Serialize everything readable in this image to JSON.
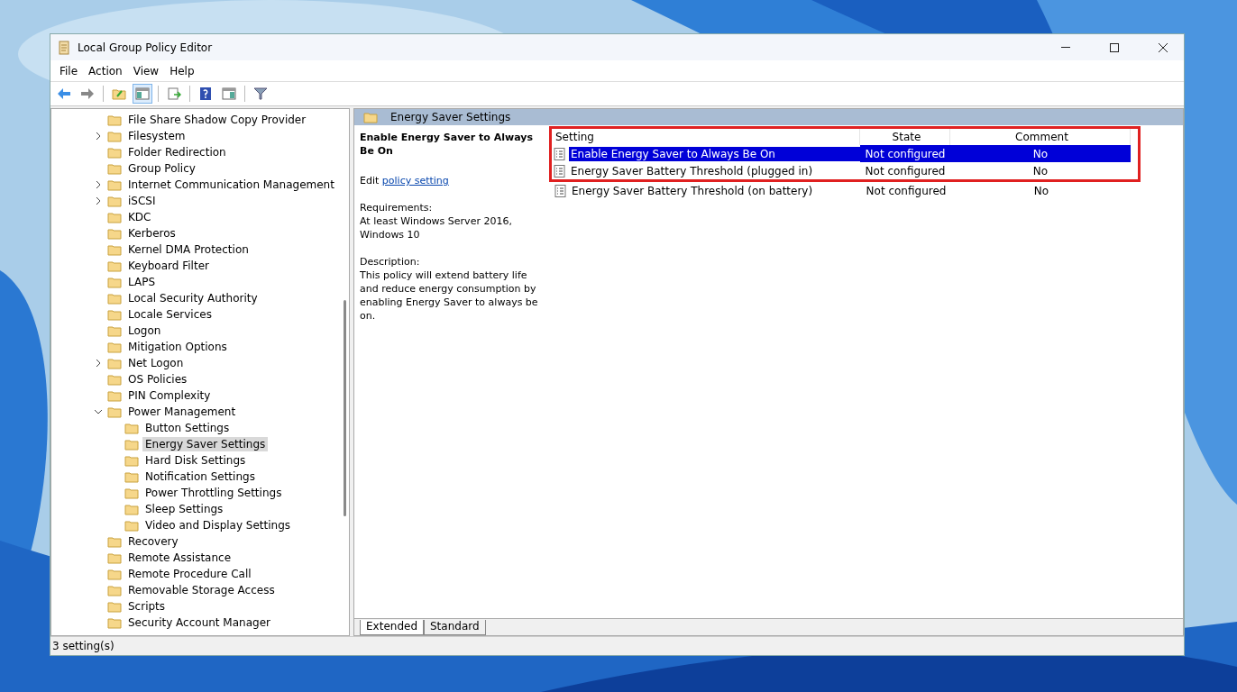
{
  "window": {
    "title": "Local Group Policy Editor"
  },
  "menu": [
    "File",
    "Action",
    "View",
    "Help"
  ],
  "toolbar": [
    {
      "kind": "back"
    },
    {
      "kind": "forward"
    },
    {
      "kind": "sep"
    },
    {
      "kind": "up"
    },
    {
      "kind": "tree",
      "selected": true
    },
    {
      "kind": "sep"
    },
    {
      "kind": "export"
    },
    {
      "kind": "sep"
    },
    {
      "kind": "help"
    },
    {
      "kind": "pane"
    },
    {
      "kind": "sep"
    },
    {
      "kind": "filter"
    }
  ],
  "tree": [
    {
      "label": "File Share Shadow Copy Provider",
      "expandable": false,
      "selected": false
    },
    {
      "label": "Filesystem",
      "expandable": true,
      "expanded": false,
      "selected": false
    },
    {
      "label": "Folder Redirection",
      "expandable": false,
      "selected": false
    },
    {
      "label": "Group Policy",
      "expandable": false,
      "selected": false
    },
    {
      "label": "Internet Communication Management",
      "expandable": true,
      "expanded": false,
      "selected": false
    },
    {
      "label": "iSCSI",
      "expandable": true,
      "expanded": false,
      "selected": false
    },
    {
      "label": "KDC",
      "expandable": false,
      "selected": false
    },
    {
      "label": "Kerberos",
      "expandable": false,
      "selected": false
    },
    {
      "label": "Kernel DMA Protection",
      "expandable": false,
      "selected": false
    },
    {
      "label": "Keyboard Filter",
      "expandable": false,
      "selected": false
    },
    {
      "label": "LAPS",
      "expandable": false,
      "selected": false
    },
    {
      "label": "Local Security Authority",
      "expandable": false,
      "selected": false
    },
    {
      "label": "Locale Services",
      "expandable": false,
      "selected": false
    },
    {
      "label": "Logon",
      "expandable": false,
      "selected": false
    },
    {
      "label": "Mitigation Options",
      "expandable": false,
      "selected": false
    },
    {
      "label": "Net Logon",
      "expandable": true,
      "expanded": false,
      "selected": false
    },
    {
      "label": "OS Policies",
      "expandable": false,
      "selected": false
    },
    {
      "label": "PIN Complexity",
      "expandable": false,
      "selected": false
    },
    {
      "label": "Power Management",
      "expandable": true,
      "expanded": true,
      "selected": false,
      "children": [
        {
          "label": "Button Settings",
          "expandable": false,
          "selected": false
        },
        {
          "label": "Energy Saver Settings",
          "expandable": false,
          "selected": true
        },
        {
          "label": "Hard Disk Settings",
          "expandable": false,
          "selected": false
        },
        {
          "label": "Notification Settings",
          "expandable": false,
          "selected": false
        },
        {
          "label": "Power Throttling Settings",
          "expandable": false,
          "selected": false
        },
        {
          "label": "Sleep Settings",
          "expandable": false,
          "selected": false
        },
        {
          "label": "Video and Display Settings",
          "expandable": false,
          "selected": false
        }
      ]
    },
    {
      "label": "Recovery",
      "expandable": false,
      "selected": false
    },
    {
      "label": "Remote Assistance",
      "expandable": false,
      "selected": false
    },
    {
      "label": "Remote Procedure Call",
      "expandable": false,
      "selected": false
    },
    {
      "label": "Removable Storage Access",
      "expandable": false,
      "selected": false
    },
    {
      "label": "Scripts",
      "expandable": false,
      "selected": false
    },
    {
      "label": "Security Account Manager",
      "expandable": false,
      "selected": false
    }
  ],
  "pane_header": "Energy Saver Settings",
  "description": {
    "title": "Enable Energy Saver to Always Be On",
    "edit_prefix": "Edit",
    "edit_link": "policy setting",
    "requirements_label": "Requirements:",
    "requirements": "At least Windows Server 2016, Windows 10",
    "description_label": "Description:",
    "description": "This policy will extend battery life and reduce energy consumption by enabling Energy Saver to always be on."
  },
  "table": {
    "columns": [
      "Setting",
      "State",
      "Comment"
    ],
    "rows": [
      {
        "setting": "Enable Energy Saver to Always Be On",
        "state": "Not configured",
        "comment": "No",
        "selected": true,
        "highlighted": true
      },
      {
        "setting": "Energy Saver Battery Threshold (plugged in)",
        "state": "Not configured",
        "comment": "No",
        "selected": false,
        "highlighted": true
      },
      {
        "setting": "Energy Saver Battery Threshold (on battery)",
        "state": "Not configured",
        "comment": "No",
        "selected": false,
        "highlighted": false
      }
    ]
  },
  "tabs": [
    {
      "label": "Extended",
      "selected": true
    },
    {
      "label": "Standard",
      "selected": false
    }
  ],
  "status_bar": "3 setting(s)"
}
